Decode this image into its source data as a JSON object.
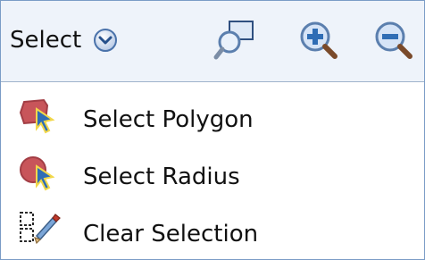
{
  "toolbar": {
    "select_label": "Select",
    "dropdown_icon": "chevron-down-circle-icon",
    "tools": [
      {
        "name": "zoom-area",
        "icon": "zoom-rectangle-icon"
      },
      {
        "name": "zoom-in",
        "icon": "zoom-in-icon"
      },
      {
        "name": "zoom-out",
        "icon": "zoom-out-icon"
      }
    ]
  },
  "menu": {
    "items": [
      {
        "label": "Select Polygon",
        "icon": "polygon-select-icon"
      },
      {
        "label": "Select Radius",
        "icon": "radius-select-icon"
      },
      {
        "label": "Clear Selection",
        "icon": "clear-selection-icon"
      }
    ]
  },
  "colors": {
    "toolbar_bg": "#eef3fa",
    "border": "#7a9cc6",
    "icon_blue": "#2f6db5",
    "shape_red": "#c8555a"
  }
}
